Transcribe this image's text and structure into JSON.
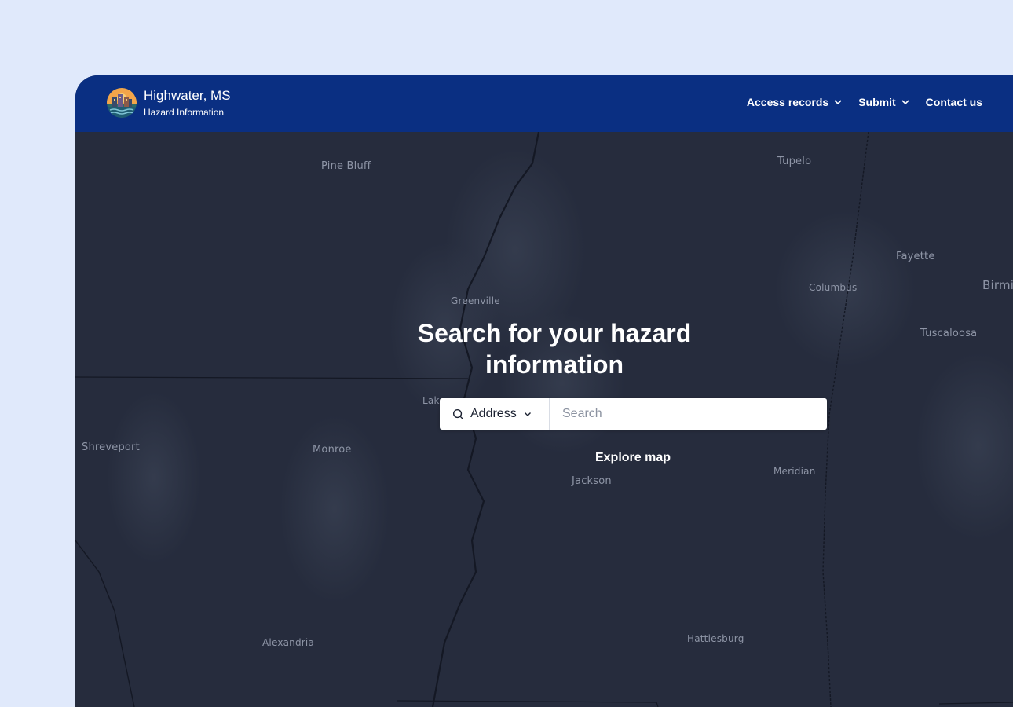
{
  "header": {
    "brand_title": "Highwater, MS",
    "brand_subtitle": "Hazard Information",
    "nav": [
      {
        "label": "Access records",
        "has_dropdown": true
      },
      {
        "label": "Submit",
        "has_dropdown": true
      },
      {
        "label": "Contact us",
        "has_dropdown": false
      }
    ]
  },
  "hero": {
    "title": "Search for your hazard information",
    "search_type": "Address",
    "search_placeholder": "Search",
    "explore_label": "Explore map"
  },
  "map": {
    "cities": [
      "Pine Bluff",
      "Tupelo",
      "Fayette",
      "Birmi",
      "Columbus",
      "Greenville",
      "Tuscaloosa",
      "Lak",
      "Shreveport",
      "Monroe",
      "Meridian",
      "Jackson",
      "Alexandria",
      "Hattiesburg"
    ]
  },
  "colors": {
    "page_bg": "#e0e9fb",
    "header_bg": "#0a2f82",
    "map_bg": "#262c3d"
  }
}
